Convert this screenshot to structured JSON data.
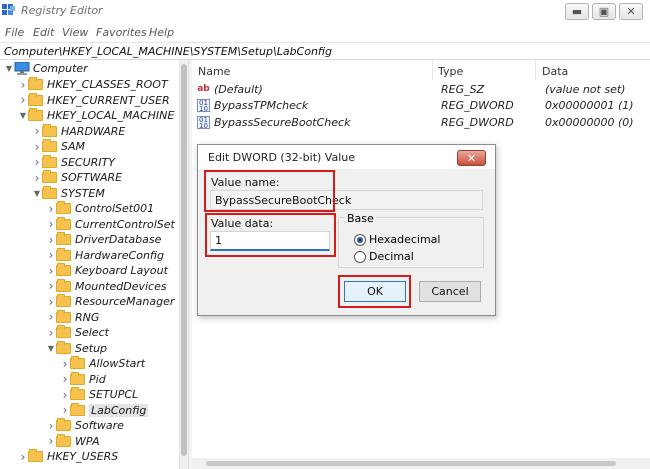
{
  "window": {
    "title": "Registry Editor"
  },
  "menu": [
    "File",
    "Edit",
    "View",
    "Favorites",
    "Help"
  ],
  "address": "Computer\\HKEY_LOCAL_MACHINE\\SYSTEM\\Setup\\LabConfig",
  "tree": {
    "root": "Computer",
    "items": [
      {
        "label": "HKEY_CLASSES_ROOT",
        "level": 1,
        "expanded": false
      },
      {
        "label": "HKEY_CURRENT_USER",
        "level": 1,
        "expanded": false
      },
      {
        "label": "HKEY_LOCAL_MACHINE",
        "level": 1,
        "expanded": true
      },
      {
        "label": "HARDWARE",
        "level": 2,
        "expanded": false
      },
      {
        "label": "SAM",
        "level": 2,
        "expanded": false
      },
      {
        "label": "SECURITY",
        "level": 2,
        "expanded": false
      },
      {
        "label": "SOFTWARE",
        "level": 2,
        "expanded": false
      },
      {
        "label": "SYSTEM",
        "level": 2,
        "expanded": true
      },
      {
        "label": "ControlSet001",
        "level": 3,
        "expanded": false
      },
      {
        "label": "CurrentControlSet",
        "level": 3,
        "expanded": false
      },
      {
        "label": "DriverDatabase",
        "level": 3,
        "expanded": false
      },
      {
        "label": "HardwareConfig",
        "level": 3,
        "expanded": false
      },
      {
        "label": "Keyboard Layout",
        "level": 3,
        "expanded": false
      },
      {
        "label": "MountedDevices",
        "level": 3,
        "expanded": false
      },
      {
        "label": "ResourceManager",
        "level": 3,
        "expanded": false
      },
      {
        "label": "RNG",
        "level": 3,
        "expanded": false
      },
      {
        "label": "Select",
        "level": 3,
        "expanded": false
      },
      {
        "label": "Setup",
        "level": 3,
        "expanded": true
      },
      {
        "label": "AllowStart",
        "level": 4,
        "expanded": false
      },
      {
        "label": "Pid",
        "level": 4,
        "expanded": false
      },
      {
        "label": "SETUPCL",
        "level": 4,
        "expanded": false
      },
      {
        "label": "LabConfig",
        "level": 4,
        "expanded": false,
        "selected": true
      },
      {
        "label": "Software",
        "level": 3,
        "expanded": false
      },
      {
        "label": "WPA",
        "level": 3,
        "expanded": false
      },
      {
        "label": "HKEY_USERS",
        "level": 1,
        "expanded": false
      }
    ]
  },
  "list": {
    "columns": {
      "name": "Name",
      "type": "Type",
      "data": "Data"
    },
    "rows": [
      {
        "name": "(Default)",
        "type": "REG_SZ",
        "data": "(value not set)",
        "icon": "string-value-icon"
      },
      {
        "name": "BypassTPMcheck",
        "type": "REG_DWORD",
        "data": "0x00000001 (1)",
        "icon": "dword-value-icon"
      },
      {
        "name": "BypassSecureBootCheck",
        "type": "REG_DWORD",
        "data": "0x00000000 (0)",
        "icon": "dword-value-icon"
      }
    ]
  },
  "dialog": {
    "title": "Edit DWORD (32-bit) Value",
    "value_name_label": "Value name:",
    "value_name": "BypassSecureBootCheck",
    "value_data_label": "Value data:",
    "value_data": "1",
    "base_label": "Base",
    "hex_label": "Hexadecimal",
    "dec_label": "Decimal",
    "base_selected": "Hexadecimal",
    "ok_label": "OK",
    "cancel_label": "Cancel"
  },
  "colors": {
    "highlight": "#d51c1c",
    "folder": "#f4c24d"
  }
}
